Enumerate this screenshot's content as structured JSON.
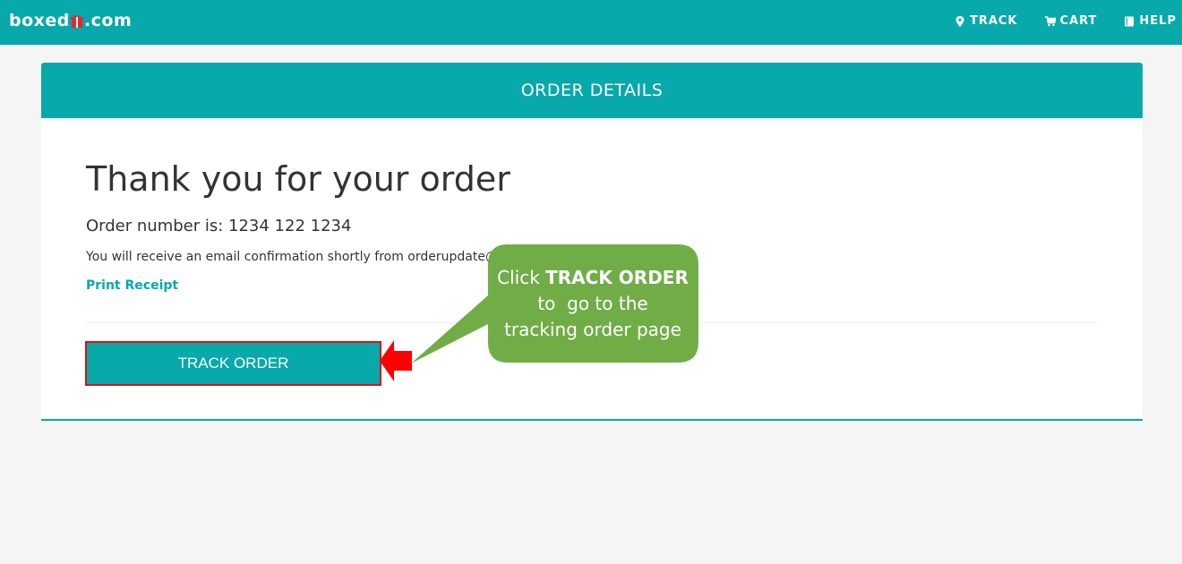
{
  "header": {
    "logo_prefix": "boxed",
    "logo_suffix": ".com",
    "logo_icon": "gift-icon",
    "nav": [
      {
        "label": "TRACK",
        "icon": "map-marker-icon"
      },
      {
        "label": "CART",
        "icon": "cart-icon"
      },
      {
        "label": "HELP",
        "icon": "book-icon"
      }
    ]
  },
  "card": {
    "header_title": "ORDER DETAILS",
    "heading": "Thank you for your order",
    "order_number_label": "Order number is: 1234 122 1234",
    "email_note": "You will receive an email confirmation shortly from orderupdate@bo",
    "print_receipt": "Print Receipt",
    "track_button": "TRACK ORDER"
  },
  "callout": {
    "line1_prefix": "Click ",
    "line1_bold": "TRACK ORDER",
    "line2": "to  go to the",
    "line3": "tracking order page"
  },
  "colors": {
    "brand": "#07a9aa",
    "background": "#f5f5f5",
    "callout": "#70ad47",
    "highlight": "#e01010"
  }
}
